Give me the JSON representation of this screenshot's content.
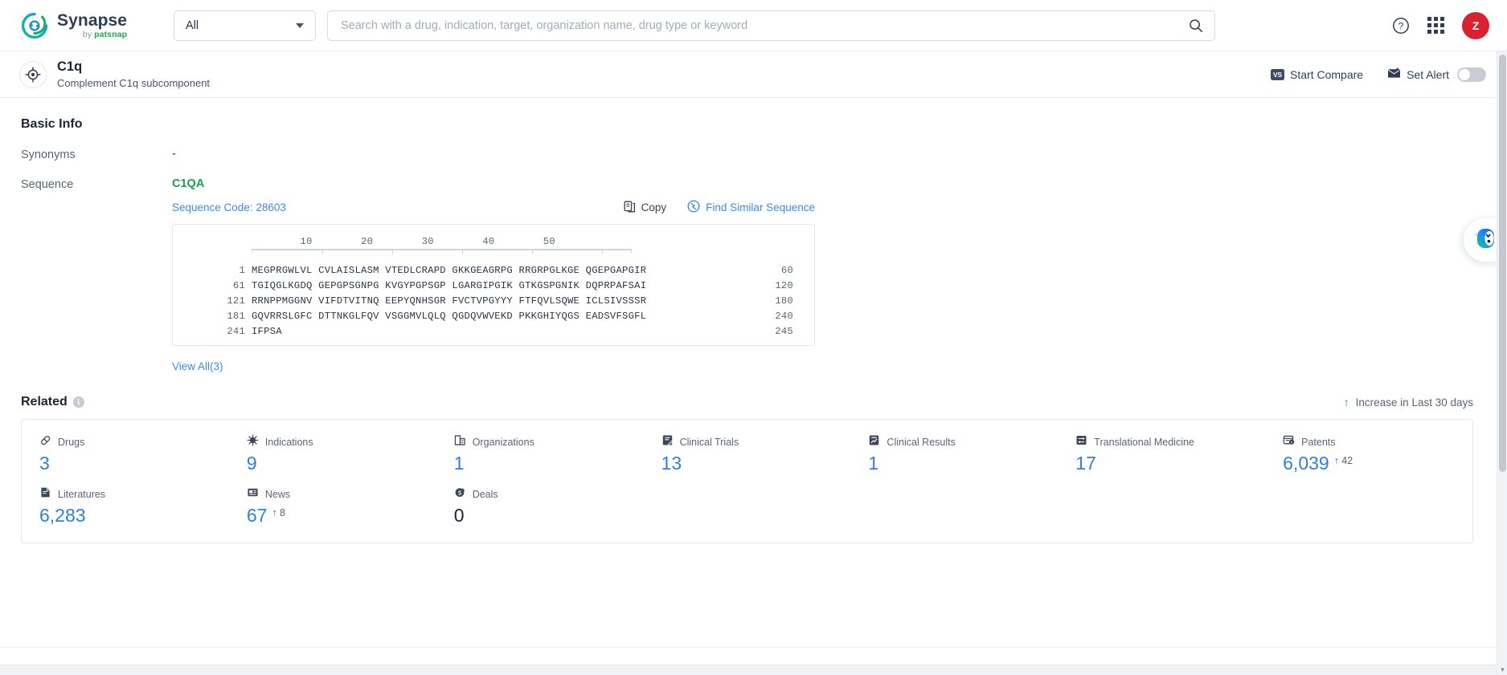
{
  "brand": {
    "name": "Synapse",
    "by": "by ",
    "company": "patsnap"
  },
  "search": {
    "scope_value": "All",
    "placeholder": "Search with a drug, indication, target, organization name, drug type or keyword",
    "value": ""
  },
  "topbar": {
    "help_icon": "question-circle-icon",
    "apps_icon": "grid-apps-icon",
    "avatar_initial": "Z"
  },
  "page_header": {
    "target_icon": "target-crosshair-icon",
    "title": "C1q",
    "subtitle": "Complement C1q subcomponent",
    "start_compare": "Start Compare",
    "compare_badge": "VS",
    "set_alert": "Set Alert",
    "alert_toggle_on": false
  },
  "basic_info": {
    "heading": "Basic Info",
    "synonyms_label": "Synonyms",
    "synonyms_value": "-",
    "sequence_label": "Sequence",
    "gene": "C1QA",
    "sequence_code": "Sequence Code: 28603",
    "copy_label": "Copy",
    "find_similar_label": "Find Similar Sequence",
    "view_all": "View All(3)"
  },
  "sequence": {
    "ruler_ticks": [
      "10",
      "20",
      "30",
      "40",
      "50"
    ],
    "ruler_text": "        10        20        30        40        50",
    "lines": [
      {
        "start": "1",
        "residues": "MEGPRGWLVL CVLAISLASM VTEDLCRAPD GKKGEAGRPG RRGRPGLKGE QGEPGAPGIR",
        "end": "60"
      },
      {
        "start": "61",
        "residues": "TGIQGLKGDQ GEPGPSGNPG KVGYPGPSGP LGARGIPGIK GTKGSPGNIK DQPRPAFSAI",
        "end": "120"
      },
      {
        "start": "121",
        "residues": "RRNPPMGGNV VIFDTVITNQ EEPYQNHSGR FVCTVPGYYY FTFQVLSQWE ICLSIVSSSR",
        "end": "180"
      },
      {
        "start": "181",
        "residues": "GQVRRSLGFC DTTNKGLFQV VSGGMVLQLQ QGDQVWVEKD PKKGHIYQGS EADSVFSGFL",
        "end": "240"
      },
      {
        "start": "241",
        "residues": "IFPSA",
        "end": "245"
      }
    ]
  },
  "related": {
    "heading": "Related",
    "info_glyph": "i",
    "legend": "Increase in Last 30 days",
    "legend_arrow": "up-arrow-icon",
    "stats": [
      {
        "label": "Drugs",
        "icon": "pill-icon",
        "value": "3",
        "delta": null,
        "is_zero": false
      },
      {
        "label": "Indications",
        "icon": "virus-icon",
        "value": "9",
        "delta": null,
        "is_zero": false
      },
      {
        "label": "Organizations",
        "icon": "building-icon",
        "value": "1",
        "delta": null,
        "is_zero": false
      },
      {
        "label": "Clinical Trials",
        "icon": "clinical-trial-icon",
        "value": "13",
        "delta": null,
        "is_zero": false
      },
      {
        "label": "Clinical Results",
        "icon": "clinical-result-icon",
        "value": "1",
        "delta": null,
        "is_zero": false
      },
      {
        "label": "Translational Medicine",
        "icon": "translational-icon",
        "value": "17",
        "delta": null,
        "is_zero": false
      },
      {
        "label": "Patents",
        "icon": "patent-icon",
        "value": "6,039",
        "delta": "42",
        "is_zero": false
      },
      {
        "label": "Literatures",
        "icon": "literature-icon",
        "value": "6,283",
        "delta": null,
        "is_zero": false
      },
      {
        "label": "News",
        "icon": "news-icon",
        "value": "67",
        "delta": "8",
        "is_zero": false
      },
      {
        "label": "Deals",
        "icon": "deals-icon",
        "value": "0",
        "delta": null,
        "is_zero": true
      }
    ]
  },
  "ai_widget": {
    "icon": "ai-assistant-icon"
  },
  "colors": {
    "link_blue": "#3b8ce8",
    "stat_blue": "#2d7fe0",
    "gene_green": "#17a04a",
    "increase_green": "#21a453",
    "avatar_red": "#d8222f",
    "heading_dark": "#1b2435"
  }
}
